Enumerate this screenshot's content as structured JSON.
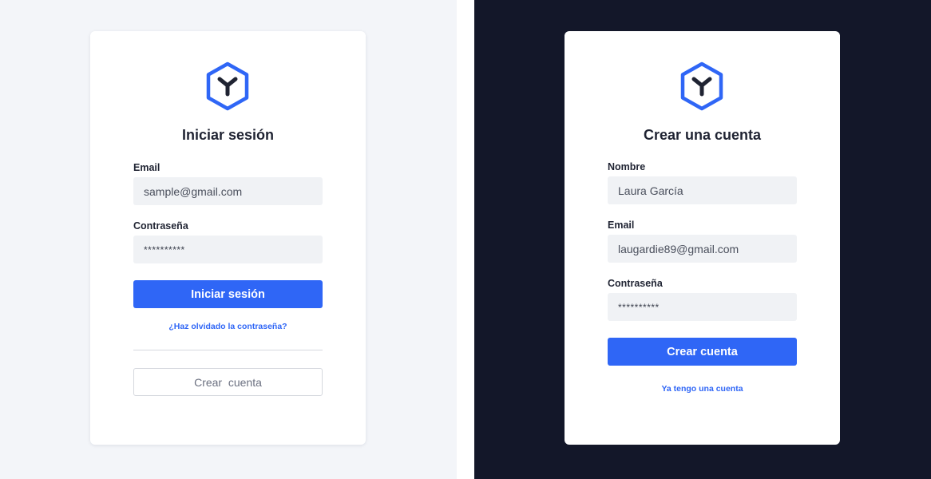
{
  "colors": {
    "accent": "#2f66f6",
    "left_background": "#f3f5f9",
    "right_background": "#131729",
    "card": "#ffffff",
    "field_background": "#f0f2f5"
  },
  "icons": {
    "logo": "hexagon-y-logo-icon"
  },
  "login": {
    "title": "Iniciar sesión",
    "email_label": "Email",
    "email_value": "sample@gmail.com",
    "password_label": "Contraseña",
    "password_value": "**********",
    "submit_label": "Iniciar sesión",
    "forgot_link": "¿Haz olvidado la contraseña?",
    "create_account_label": "Crear  cuenta"
  },
  "register": {
    "title": "Crear una cuenta",
    "name_label": "Nombre",
    "name_value": "Laura García",
    "email_label": "Email",
    "email_value": "laugardie89@gmail.com",
    "password_label": "Contraseña",
    "password_value": "**********",
    "submit_label": "Crear cuenta",
    "have_account_link": "Ya tengo una cuenta"
  }
}
